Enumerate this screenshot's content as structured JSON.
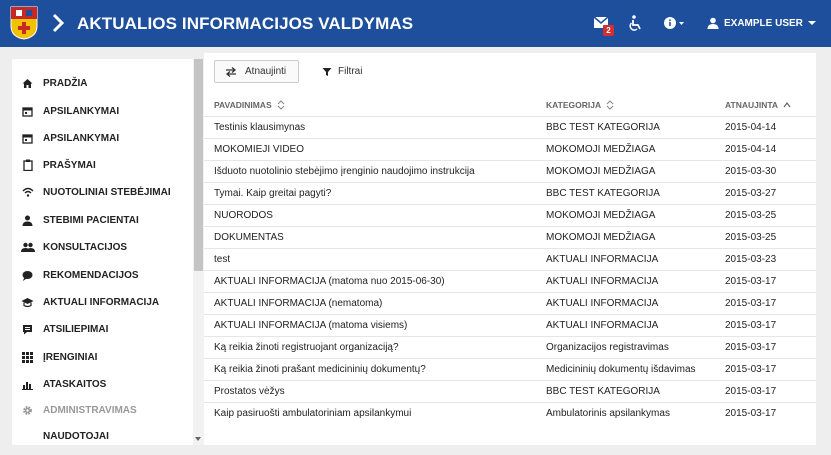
{
  "header": {
    "title": "AKTUALIOS INFORMACIJOS VALDYMAS",
    "mail_badge": "2",
    "user_name": "EXAMPLE USER",
    "background": "#1d4f9c"
  },
  "sidebar": {
    "items": [
      {
        "label": "PRADŽIA",
        "icon": "home-icon"
      },
      {
        "label": "APSILANKYMAI",
        "icon": "calendar-icon"
      },
      {
        "label": "APSILANKYMAI",
        "icon": "calendar-icon"
      },
      {
        "label": "PRAŠYMAI",
        "icon": "clipboard-icon"
      },
      {
        "label": "NUOTOLINIAI STEBĖJIMAI",
        "icon": "wifi-icon"
      },
      {
        "label": "STEBIMI PACIENTAI",
        "icon": "person-icon"
      },
      {
        "label": "KONSULTACIJOS",
        "icon": "people-icon"
      },
      {
        "label": "REKOMENDACIJOS",
        "icon": "chat-bubble-icon"
      },
      {
        "label": "AKTUALI INFORMACIJA",
        "icon": "school-icon"
      },
      {
        "label": "ATSILIEPIMAI",
        "icon": "feedback-icon"
      },
      {
        "label": "ĮRENGINIAI",
        "icon": "grid-icon"
      },
      {
        "label": "ATASKAITOS",
        "icon": "bar-chart-icon"
      },
      {
        "label": "ADMINISTRAVIMAS",
        "icon": "gear-icon"
      },
      {
        "label": "NAUDOTOJAI",
        "icon": ""
      }
    ]
  },
  "toolbar": {
    "refresh_label": "Atnaujinti",
    "filter_label": "Filtrai"
  },
  "table": {
    "columns": [
      "PAVADINIMAS",
      "KATEGORIJA",
      "ATNAUJINTA"
    ],
    "rows": [
      [
        "Testinis klausimynas",
        "BBC TEST KATEGORIJA",
        "2015-04-14"
      ],
      [
        "MOKOMIEJI VIDEO",
        "MOKOMOJI MEDŽIAGA",
        "2015-04-14"
      ],
      [
        "Išduoto nuotolinio stebėjimo įrenginio naudojimo instrukcija",
        "MOKOMOJI MEDŽIAGA",
        "2015-03-30"
      ],
      [
        "Tymai. Kaip greitai pagyti?",
        "BBC TEST KATEGORIJA",
        "2015-03-27"
      ],
      [
        "NUORODOS",
        "MOKOMOJI MEDŽIAGA",
        "2015-03-25"
      ],
      [
        "DOKUMENTAS",
        "MOKOMOJI MEDŽIAGA",
        "2015-03-25"
      ],
      [
        "test",
        "AKTUALI INFORMACIJA",
        "2015-03-23"
      ],
      [
        "AKTUALI INFORMACIJA (matoma nuo 2015-06-30)",
        "AKTUALI INFORMACIJA",
        "2015-03-17"
      ],
      [
        "AKTUALI INFORMACIJA (nematoma)",
        "AKTUALI INFORMACIJA",
        "2015-03-17"
      ],
      [
        "AKTUALI INFORMACIJA (matoma visiems)",
        "AKTUALI INFORMACIJA",
        "2015-03-17"
      ],
      [
        "Ką reikia žinoti registruojant organizaciją?",
        "Organizacijos registravimas",
        "2015-03-17"
      ],
      [
        "Ką reikia žinoti prašant medicininių dokumentų?",
        "Medicininių dokumentų išdavimas",
        "2015-03-17"
      ],
      [
        "Prostatos vėžys",
        "BBC TEST KATEGORIJA",
        "2015-03-17"
      ],
      [
        "Kaip pasiruošti ambulatoriniam apsilankymui",
        "Ambulatorinis apsilankymas",
        "2015-03-17"
      ]
    ]
  }
}
